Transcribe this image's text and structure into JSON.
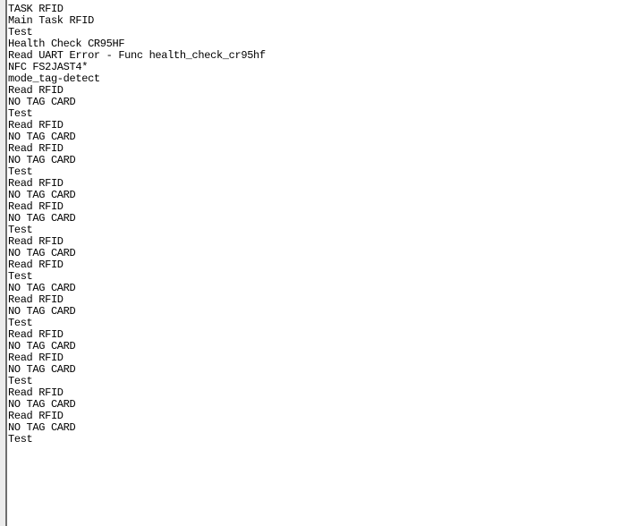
{
  "terminal": {
    "lines": [
      "NO TAG CARD",
      "TASK RFID",
      "Main Task RFID",
      "Test",
      "Health Check CR95HF",
      "Read UART Error - Func health_check_cr95hf",
      "NFC FS2JAST4*",
      "mode_tag-detect",
      "Read RFID",
      "NO TAG CARD",
      "Test",
      "Read RFID",
      "NO TAG CARD",
      "Read RFID",
      "NO TAG CARD",
      "Test",
      "Read RFID",
      "NO TAG CARD",
      "Read RFID",
      "NO TAG CARD",
      "Test",
      "Read RFID",
      "NO TAG CARD",
      "Read RFID",
      "Test",
      "NO TAG CARD",
      "Read RFID",
      "NO TAG CARD",
      "Test",
      "Read RFID",
      "NO TAG CARD",
      "Read RFID",
      "NO TAG CARD",
      "Test",
      "Read RFID",
      "NO TAG CARD",
      "Read RFID",
      "NO TAG CARD",
      "Test"
    ]
  }
}
